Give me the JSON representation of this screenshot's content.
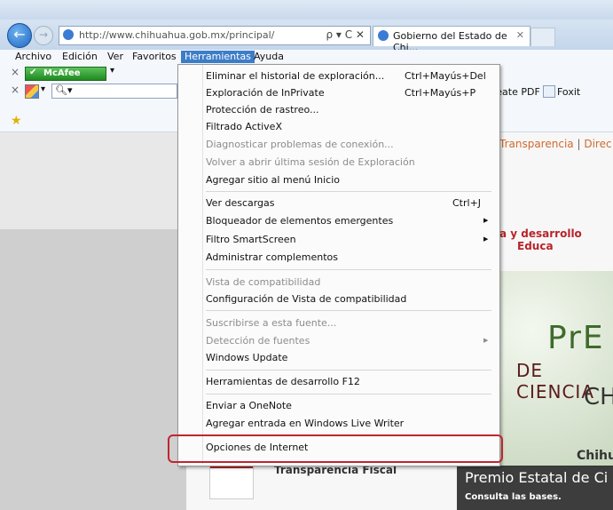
{
  "browser": {
    "address_url": "http://www.chihuahua.gob.mx/principal/",
    "address_url_domain": "chihuahua.gob.mx",
    "address_tools": "ρ ▾ C ✕",
    "tab_title": "Gobierno del Estado de Chi...",
    "tab_close": "✕"
  },
  "menubar": {
    "items": [
      "Archivo",
      "Edición",
      "Ver",
      "Favoritos",
      "Herramientas",
      "Ayuda"
    ],
    "active": "Herramientas"
  },
  "toolbars": {
    "mcafee_label": "McAfee",
    "create_pdf": "reate PDF",
    "foxit": "Foxit Message"
  },
  "tools_menu": {
    "items": [
      {
        "label": "Eliminar el historial de exploración...",
        "shortcut": "Ctrl+Mayús+Del",
        "enabled": true
      },
      {
        "label": "Exploración de InPrivate",
        "shortcut": "Ctrl+Mayús+P",
        "enabled": true
      },
      {
        "label": "Protección de rastreo...",
        "enabled": true
      },
      {
        "label": "Filtrado ActiveX",
        "enabled": true
      },
      {
        "label": "Diagnosticar problemas de conexión...",
        "enabled": false
      },
      {
        "label": "Volver a abrir última sesión de Exploración",
        "enabled": false
      },
      {
        "label": "Agregar sitio al menú Inicio",
        "enabled": true
      },
      {
        "label": "Ver descargas",
        "shortcut": "Ctrl+J",
        "enabled": true
      },
      {
        "label": "Bloqueador de elementos emergentes",
        "submenu": true,
        "enabled": true
      },
      {
        "label": "Filtro SmartScreen",
        "submenu": true,
        "enabled": true
      },
      {
        "label": "Administrar complementos",
        "enabled": true
      },
      {
        "label": "Vista de compatibilidad",
        "enabled": false
      },
      {
        "label": "Configuración de Vista de compatibilidad",
        "enabled": true
      },
      {
        "label": "Suscribirse a esta fuente...",
        "enabled": false
      },
      {
        "label": "Detección de fuentes",
        "submenu": true,
        "enabled": false
      },
      {
        "label": "Windows Update",
        "enabled": true
      },
      {
        "label": "Herramientas de desarrollo F12",
        "enabled": true
      },
      {
        "label": "Enviar a OneNote",
        "enabled": true
      },
      {
        "label": "Agregar entrada en Windows Live Writer",
        "enabled": true
      },
      {
        "label": "Opciones de Internet",
        "enabled": true,
        "highlighted": true
      }
    ]
  },
  "page": {
    "nav_transparencia": "Transparencia",
    "nav_separator": "|",
    "nav_direc": "Direc",
    "red_link_1": "a y desarrollo",
    "red_link_2": "Educa",
    "banner_pre": "PrE",
    "banner_deciencia": "DE CIENCIA",
    "banner_ch": "CH",
    "banner_chih": "Chihu",
    "caption_title": "Premio Estatal de Ci",
    "caption_sub": "Consulta las bases.",
    "fiscal_title": "Transparencia Fiscal"
  },
  "colors": {
    "menu_active": "#3d7dc8",
    "highlight_box": "#c0262d",
    "mcafee_green": "#1f8a1f"
  }
}
